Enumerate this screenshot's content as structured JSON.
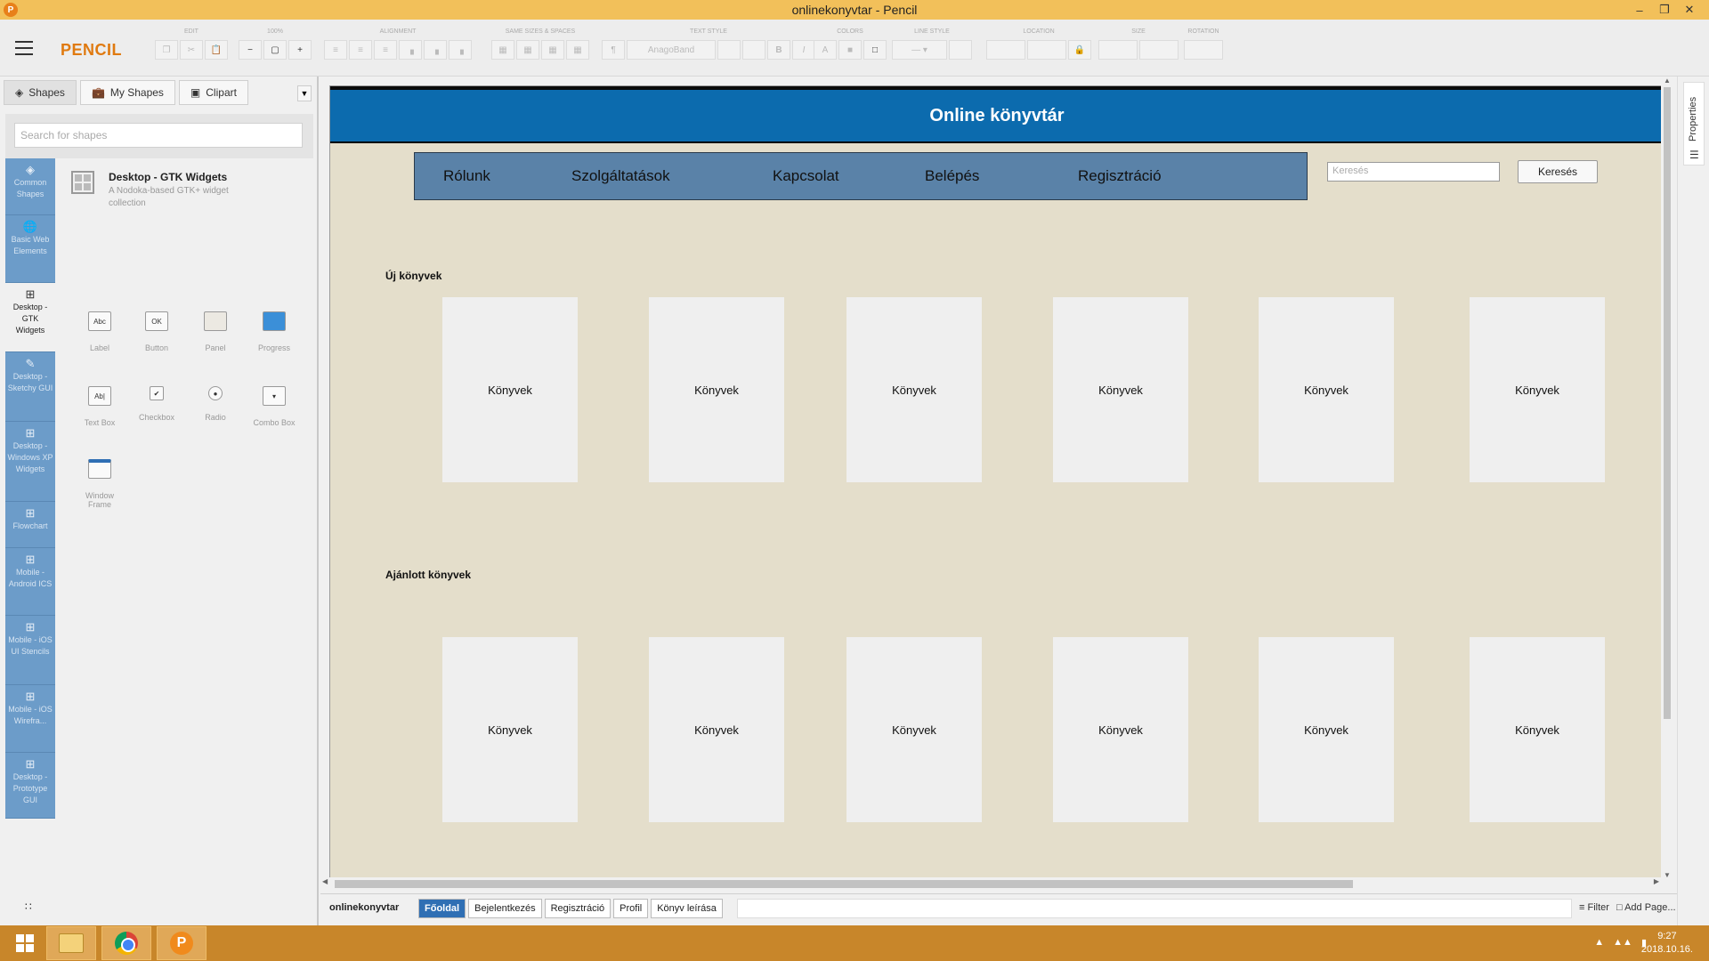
{
  "window": {
    "title": "onlinekonyvtar - Pencil",
    "app_icon": "P"
  },
  "toolbar": {
    "brand": "PENCIL",
    "groups": [
      {
        "label": "EDIT"
      },
      {
        "label": "100%"
      },
      {
        "label": "ALIGNMENT"
      },
      {
        "label": "SAME SIZES & SPACES"
      },
      {
        "label": "TEXT STYLE"
      },
      {
        "label": "COLORS"
      },
      {
        "label": "LINE STYLE"
      },
      {
        "label": "LOCATION"
      },
      {
        "label": "SIZE"
      },
      {
        "label": "ROTATION"
      }
    ],
    "font_placeholder": "AnagoBand"
  },
  "left_panel": {
    "tabs": [
      {
        "label": "Shapes",
        "icon": "layers-icon"
      },
      {
        "label": "My Shapes",
        "icon": "briefcase-icon"
      },
      {
        "label": "Clipart",
        "icon": "image-icon"
      }
    ],
    "search_placeholder": "Search for shapes",
    "categories": [
      {
        "label": "Common Shapes"
      },
      {
        "label": "Basic Web Elements"
      },
      {
        "label": "Desktop - GTK Widgets"
      },
      {
        "label": "Desktop - Sketchy GUI"
      },
      {
        "label": "Desktop - Windows XP Widgets"
      },
      {
        "label": "Flowchart"
      },
      {
        "label": "Mobile - Android ICS"
      },
      {
        "label": "Mobile - iOS UI Stencils"
      },
      {
        "label": "Mobile - iOS Wirefra..."
      },
      {
        "label": "Desktop - Prototype GUI"
      }
    ],
    "collection_title": "Desktop - GTK Widgets",
    "collection_desc": "A Nodoka-based GTK+ widget collection",
    "shapes": [
      {
        "label": "Label",
        "glyph": "Abc"
      },
      {
        "label": "Button",
        "glyph": "OK"
      },
      {
        "label": "Panel",
        "glyph": ""
      },
      {
        "label": "Progress",
        "glyph": ""
      },
      {
        "label": "Text Box",
        "glyph": "Ab|"
      },
      {
        "label": "Checkbox",
        "glyph": "✔"
      },
      {
        "label": "Radio",
        "glyph": "●"
      },
      {
        "label": "Combo Box",
        "glyph": "▾"
      },
      {
        "label": "Window Frame",
        "glyph": ""
      }
    ]
  },
  "page": {
    "banner_title": "Online könyvtár",
    "nav": [
      "Rólunk",
      "Szolgáltatások",
      "Kapcsolat",
      "Belépés",
      "Regisztráció"
    ],
    "search_placeholder": "Keresés",
    "search_button": "Keresés",
    "sections": [
      {
        "title": "Új könyvek",
        "books": [
          "Könyvek",
          "Könyvek",
          "Könyvek",
          "Könyvek",
          "Könyvek",
          "Könyvek"
        ]
      },
      {
        "title": "Ajánlott könyvek",
        "books": [
          "Könyvek",
          "Könyvek",
          "Könyvek",
          "Könyvek",
          "Könyvek",
          "Könyvek"
        ]
      }
    ]
  },
  "right_panel": {
    "properties_label": "Properties"
  },
  "page_bar": {
    "document": "onlinekonyvtar",
    "tabs": [
      "Főoldal",
      "Bejelentkezés",
      "Regisztráció",
      "Profil",
      "Könyv leírása"
    ],
    "active_tab": "Főoldal",
    "filter": "Filter",
    "add_page": "Add Page..."
  },
  "taskbar": {
    "time": "9:27",
    "date": "2018.10.16."
  }
}
